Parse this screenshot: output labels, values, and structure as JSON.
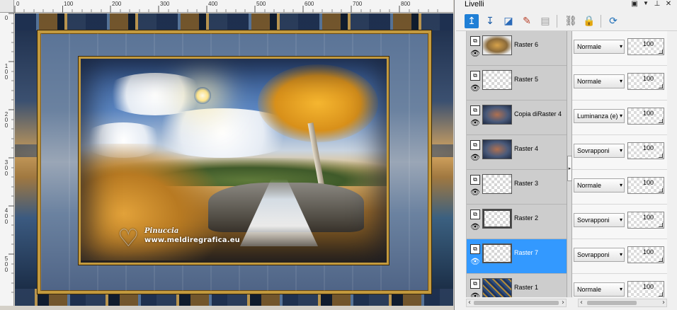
{
  "rulers": {
    "horizontal": [
      "0",
      "100",
      "200",
      "300",
      "400",
      "500",
      "600",
      "700",
      "800"
    ],
    "vertical": [
      "0",
      "100",
      "200",
      "300",
      "400",
      "500"
    ]
  },
  "watermark": {
    "name": "Pinuccia",
    "url": "www.meldiregrafica.eu"
  },
  "panel": {
    "title": "Livelli",
    "header_buttons": [
      "pin",
      "menu",
      "dock",
      "close"
    ],
    "toolbar": [
      "new-raster-layer",
      "new-vector-layer",
      "new-mask-layer",
      "delete-layer",
      "link-layers",
      "lock-layer",
      "layer-properties"
    ]
  },
  "layers": [
    {
      "name": "Raster 6",
      "blend": "Normale",
      "opacity": "100",
      "thumb": "image",
      "selected": false
    },
    {
      "name": "Raster 5",
      "blend": "Normale",
      "opacity": "100",
      "thumb": "transparent",
      "selected": false
    },
    {
      "name": "Copia diRaster 4",
      "blend": "Luminanza (e)",
      "opacity": "100",
      "thumb": "dark",
      "selected": false
    },
    {
      "name": "Raster 4",
      "blend": "Sovrapponi",
      "opacity": "100",
      "thumb": "dark",
      "selected": false
    },
    {
      "name": "Raster 3",
      "blend": "Normale",
      "opacity": "100",
      "thumb": "transparent",
      "selected": false
    },
    {
      "name": "Raster 2",
      "blend": "Sovrapponi",
      "opacity": "100",
      "thumb": "transparent-frame",
      "selected": false
    },
    {
      "name": "Raster 7",
      "blend": "Sovrapponi",
      "opacity": "100",
      "thumb": "transparent-frame",
      "selected": true
    },
    {
      "name": "Raster 1",
      "blend": "Normale",
      "opacity": "100",
      "thumb": "texture",
      "selected": false
    }
  ],
  "colors": {
    "selection": "#3399ff",
    "frame_gold": "#c39a3e"
  }
}
